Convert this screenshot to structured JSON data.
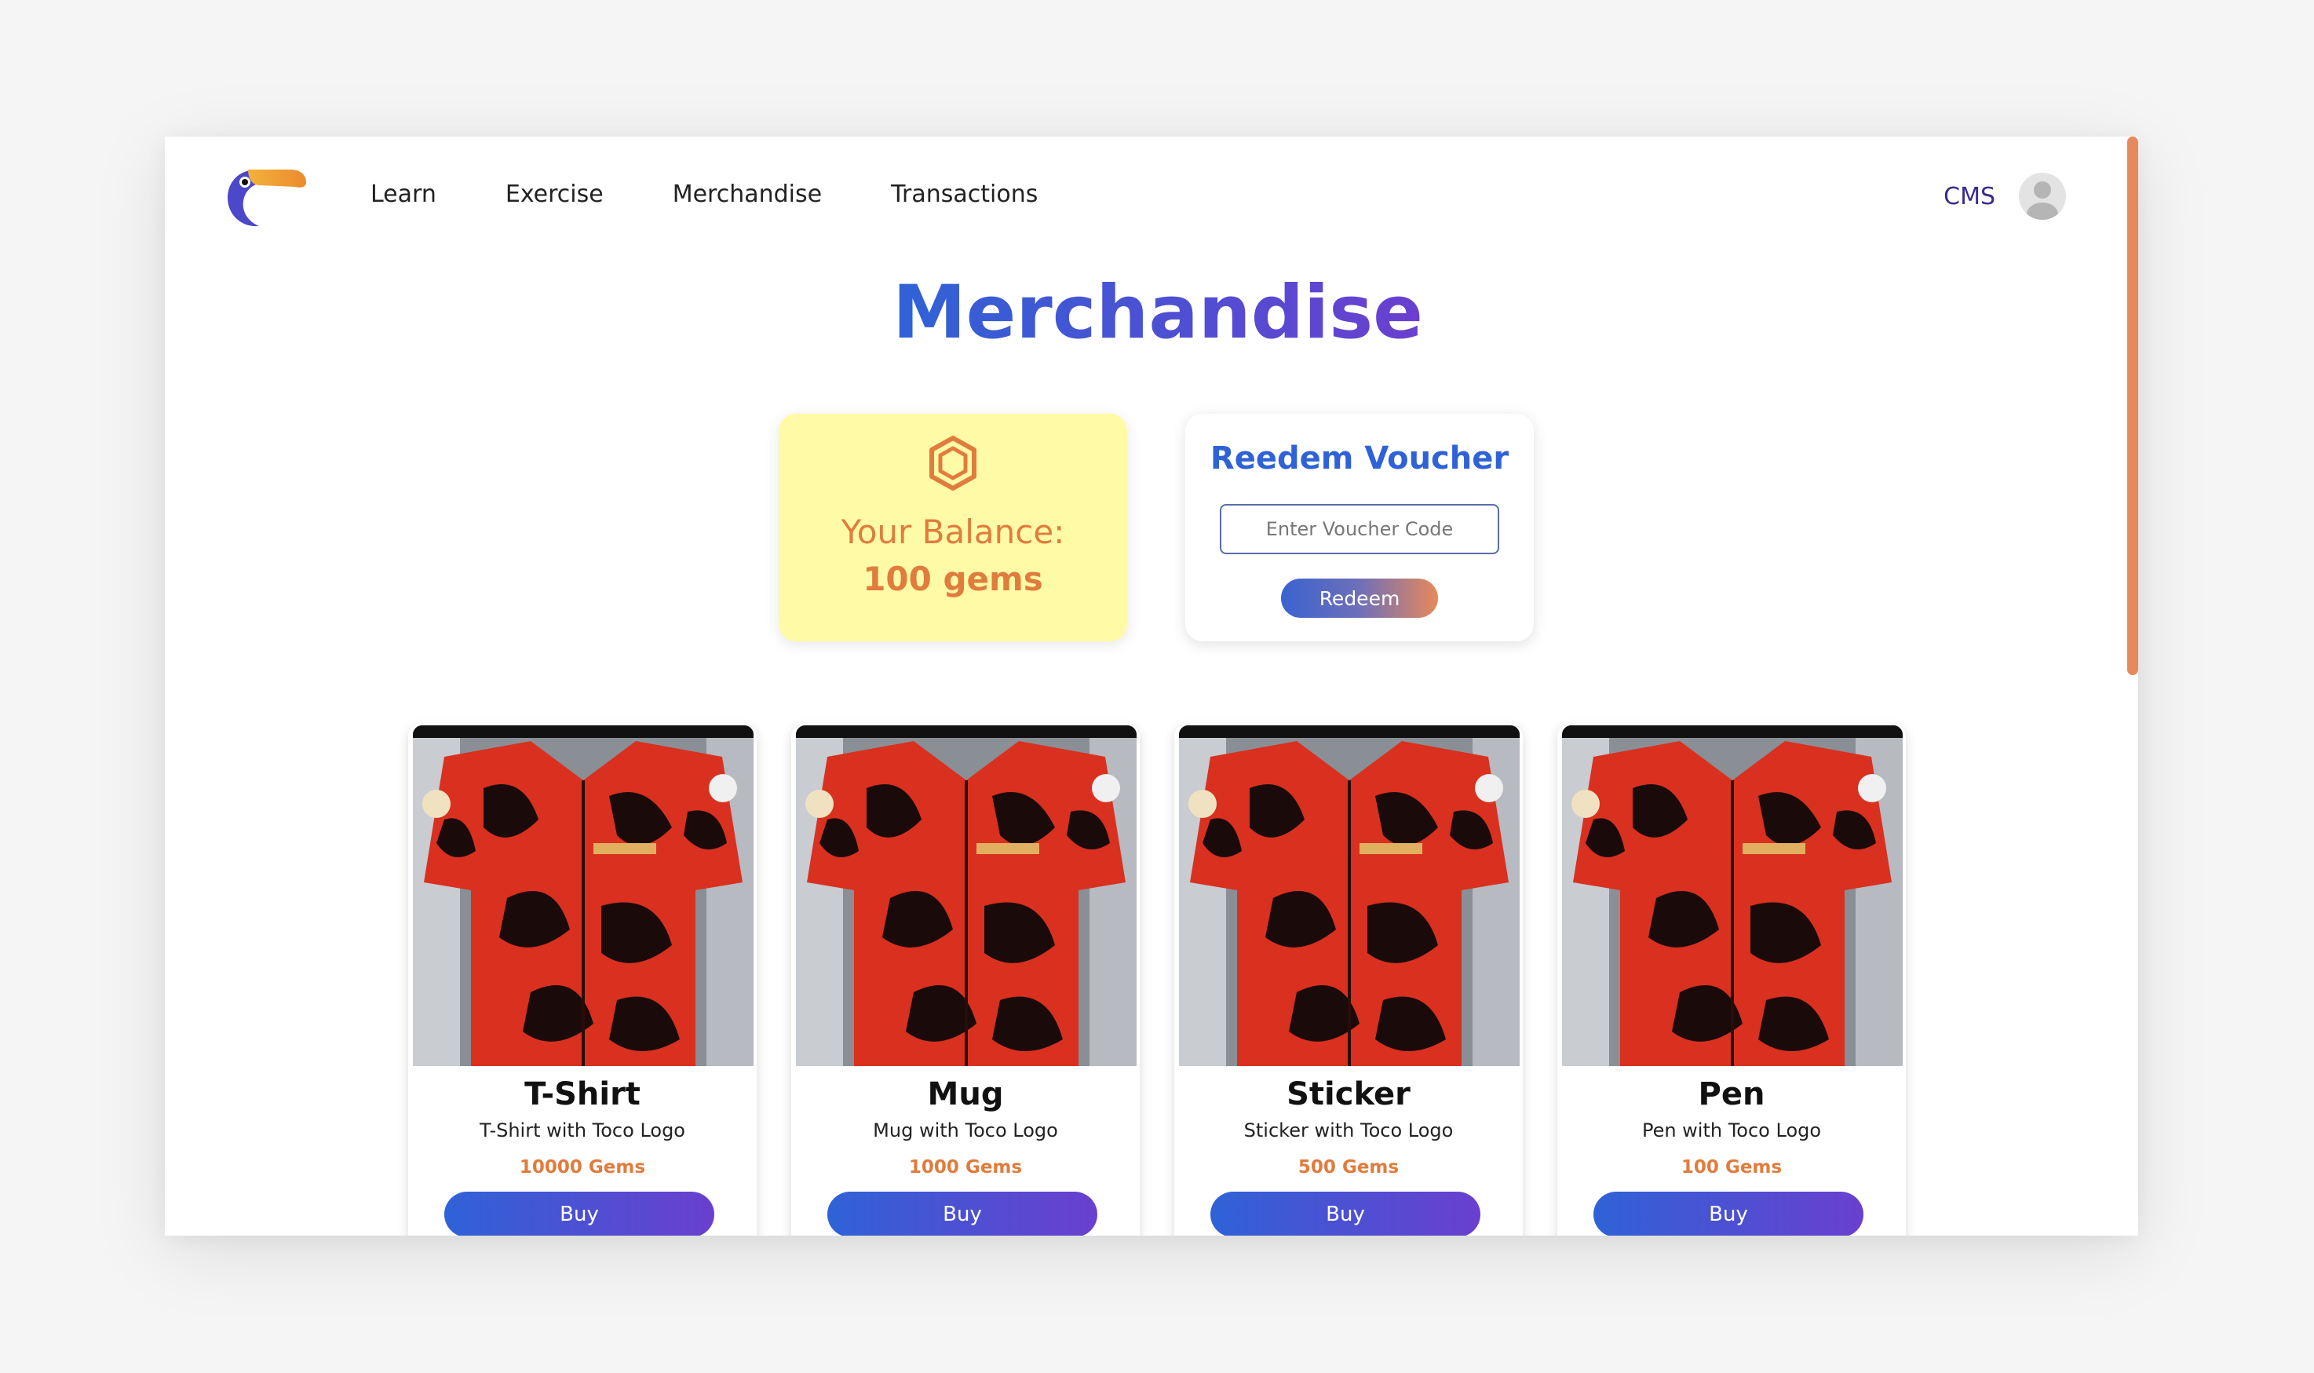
{
  "nav": {
    "logo_name": "toucan-logo",
    "items": [
      {
        "label": "Learn"
      },
      {
        "label": "Exercise"
      },
      {
        "label": "Merchandise"
      },
      {
        "label": "Transactions"
      }
    ],
    "cms_label": "CMS"
  },
  "page": {
    "title": "Merchandise"
  },
  "balance": {
    "label": "Your Balance:",
    "value": "100 gems",
    "icon": "gem-hexagon-icon"
  },
  "voucher": {
    "title": "Reedem Voucher",
    "input_value": "",
    "placeholder": "Enter Voucher Code",
    "button_label": "Redeem"
  },
  "products": [
    {
      "name": "T-Shirt",
      "description": "T-Shirt with Toco Logo",
      "price": "10000 Gems",
      "button_label": "Buy"
    },
    {
      "name": "Mug",
      "description": "Mug with Toco Logo",
      "price": "1000 Gems",
      "button_label": "Buy"
    },
    {
      "name": "Sticker",
      "description": "Sticker with Toco Logo",
      "price": "500 Gems",
      "button_label": "Buy"
    },
    {
      "name": "Pen",
      "description": "Pen with Toco Logo",
      "price": "100 Gems",
      "button_label": "Buy"
    }
  ],
  "colors": {
    "accent_blue": "#2f62d6",
    "accent_purple": "#6a3fcf",
    "accent_orange": "#e07c3e",
    "balance_bg": "#fffaa6"
  }
}
